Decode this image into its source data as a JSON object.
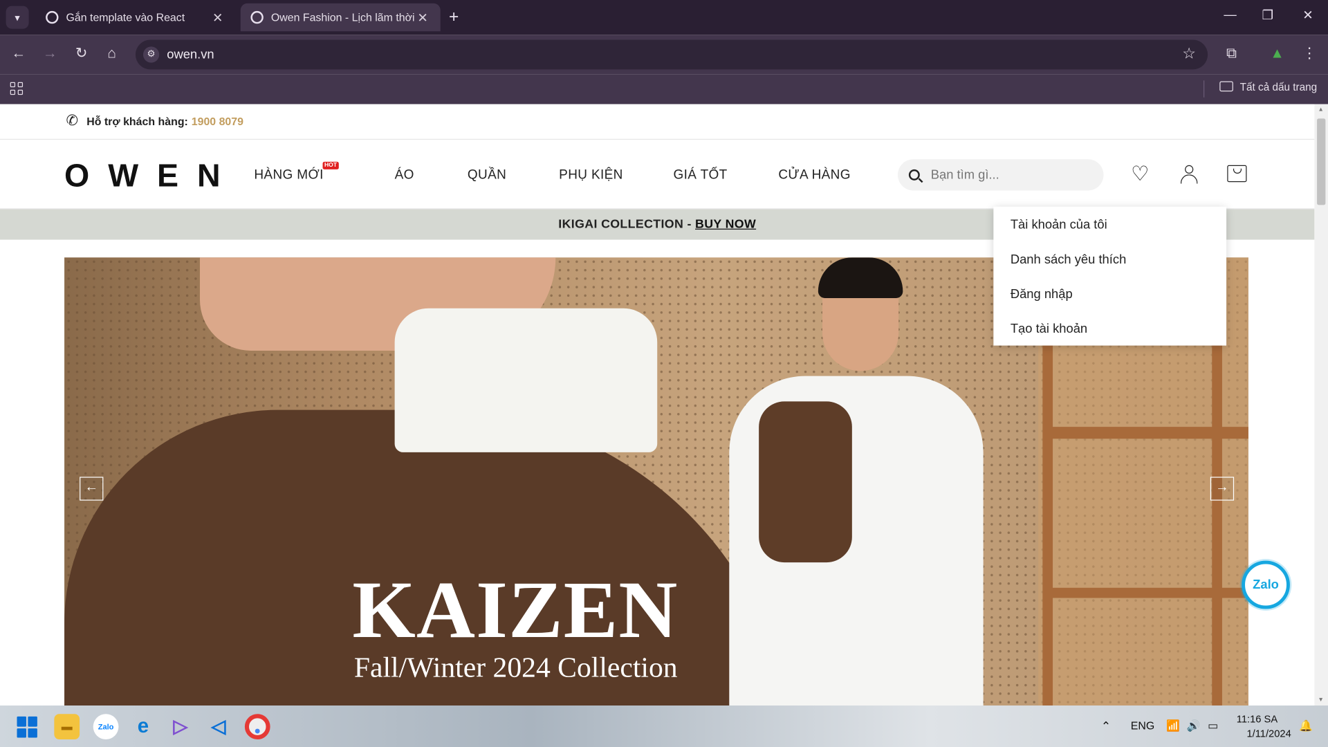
{
  "browser": {
    "tabs": [
      {
        "title": "Gắn template vào React",
        "active": false
      },
      {
        "title": "Owen Fashion - Lịch lãm thời trang",
        "active": true
      }
    ],
    "new_tab": "+",
    "url": "owen.vn",
    "bookmarks_all": "Tất cả dấu trang"
  },
  "site": {
    "support_label": "Hỗ trợ khách hàng:",
    "support_phone": "1900 8079",
    "logo": "OWEN",
    "nav": [
      "HÀNG MỚI",
      "ÁO",
      "QUẦN",
      "PHỤ KIỆN",
      "GIÁ TỐT",
      "CỬA HÀNG"
    ],
    "hot_badge": "HOT",
    "search_placeholder": "Bạn tìm gì...",
    "promo_text": "IKIGAI COLLECTION -",
    "promo_link": "BUY NOW",
    "hero_title": "KAIZEN",
    "hero_subtitle": "Fall/Winter 2024 Collection",
    "account_menu": [
      "Tài khoản của tôi",
      "Danh sách yêu thích",
      "Đăng nhập",
      "Tạo tài khoản"
    ],
    "zalo_label": "Zalo"
  },
  "taskbar": {
    "lang": "ENG",
    "time": "11:16 SA",
    "date": "1/11/2024"
  },
  "colors": {
    "chrome_dark": "#2a1f33",
    "chrome_toolbar": "#43364d",
    "phone_accent": "#c29d5e",
    "promo_bg": "#d5d8d2",
    "zalo_blue": "#16a7e0"
  }
}
